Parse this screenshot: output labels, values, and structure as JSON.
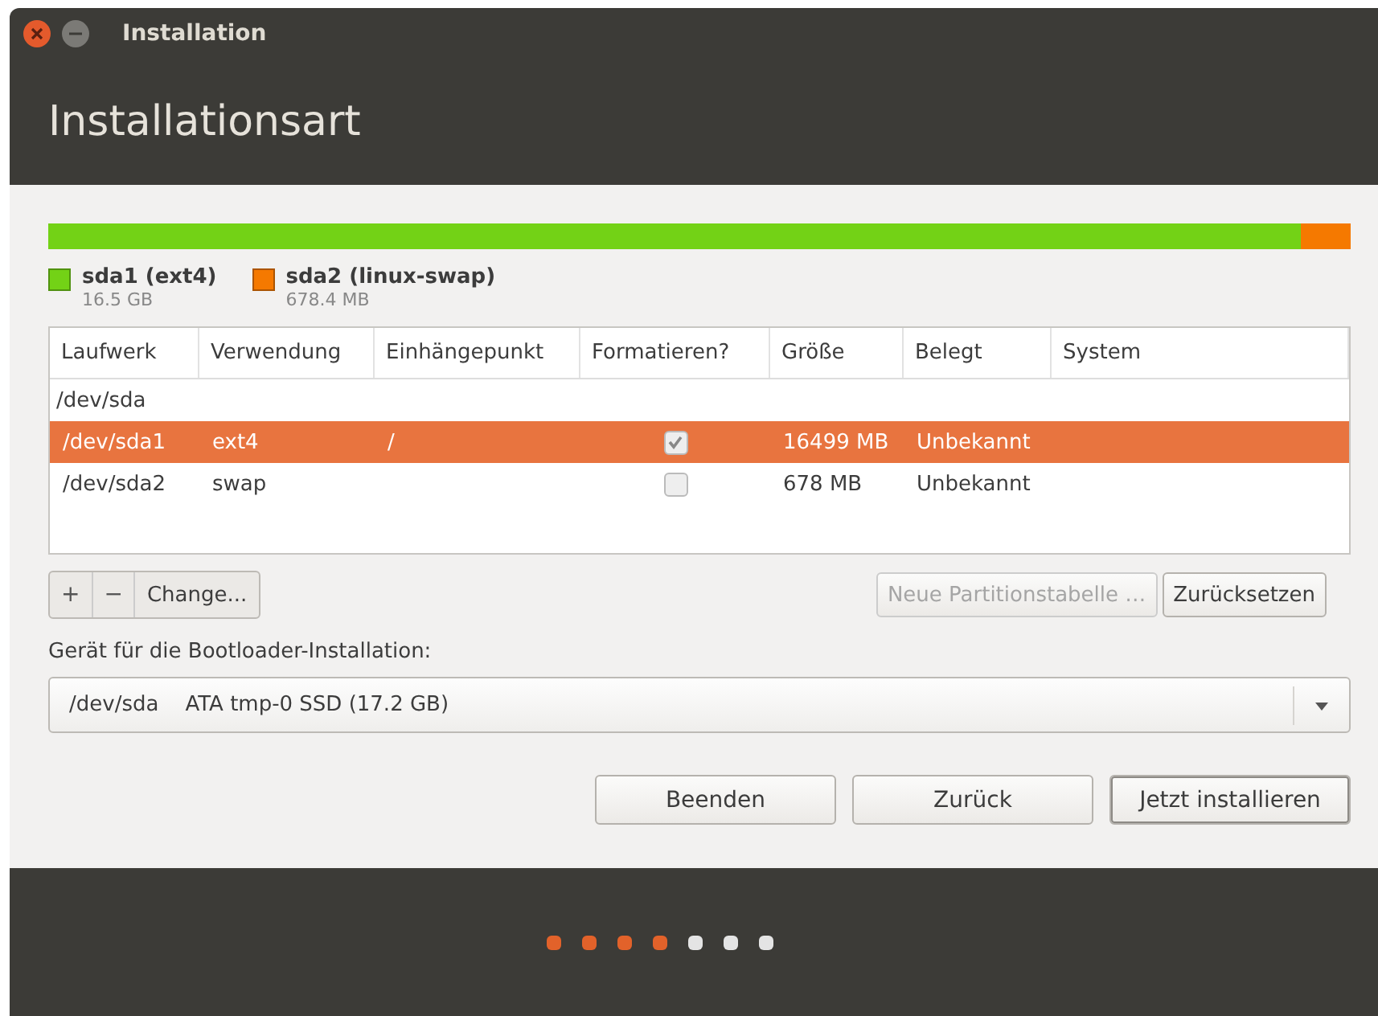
{
  "window": {
    "title": "Installation"
  },
  "header": {
    "title": "Installationsart"
  },
  "partition_bar": {
    "level": 0.962
  },
  "partitions": [
    {
      "name": "sda1 (ext4)",
      "size": "16.5 GB",
      "color": "#73d216"
    },
    {
      "name": "sda2 (linux-swap)",
      "size": "678.4 MB",
      "color": "#f57900"
    }
  ],
  "table": {
    "columns": [
      "Laufwerk",
      "Verwendung",
      "Einhängepunkt",
      "Formatieren?",
      "Größe",
      "Belegt",
      "System"
    ],
    "rows": [
      {
        "kind": "device",
        "device": "/dev/sda",
        "selected": false
      },
      {
        "kind": "partition",
        "device": "/dev/sda1",
        "type": "ext4",
        "mount": "/",
        "format": true,
        "size": "16499 MB",
        "used": "Unbekannt",
        "selected": true
      },
      {
        "kind": "partition",
        "device": "/dev/sda2",
        "type": "swap",
        "format": false,
        "size": "678 MB",
        "used": "Unbekannt",
        "selected": false
      }
    ]
  },
  "toolbar": {
    "add": "+",
    "remove": "−",
    "change": "Change...",
    "new_table": {
      "label": "Neue Partitionstabelle …",
      "disabled": true
    },
    "reset": {
      "label": "Zurücksetzen",
      "disabled": false
    }
  },
  "bootloader": {
    "label": "Gerät für die Bootloader-Installation:",
    "device": "/dev/sda",
    "description": "ATA tmp-0 SSD (17.2 GB)"
  },
  "buttons": [
    {
      "label": "Beenden",
      "default": false
    },
    {
      "label": "Zurück",
      "default": false
    },
    {
      "label": "Jetzt installieren",
      "default": true
    }
  ],
  "progress": [
    {
      "done": true
    },
    {
      "done": true
    },
    {
      "done": true
    },
    {
      "done": true
    },
    {
      "done": false
    },
    {
      "done": false
    },
    {
      "done": false
    }
  ]
}
